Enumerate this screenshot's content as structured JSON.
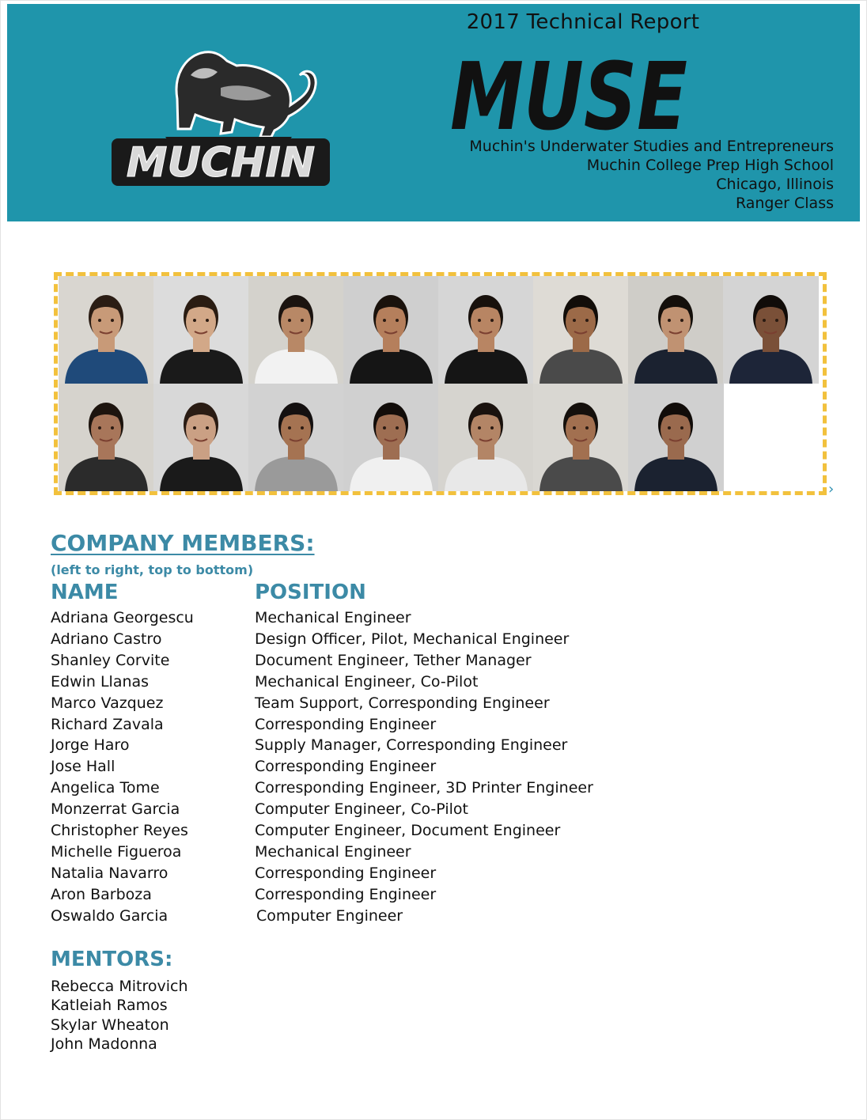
{
  "banner": {
    "report_title": "2017 Technical Report",
    "company_short": "MUSE",
    "logo_text": "MUCHIN",
    "company_full": "Muchin's Underwater Studies and Entrepreneurs",
    "school": "Muchin College Prep High School",
    "location": "Chicago, Illinois",
    "class": "Ranger Class",
    "background_color": "#1f95ab"
  },
  "photos": {
    "row1": [
      {
        "shirt": "#1f4a7a",
        "bg": "#d9d6d0",
        "skin": "#c89a78",
        "hair": "#2b1d14"
      },
      {
        "shirt": "#1a1a1a",
        "bg": "#dcdcdc",
        "skin": "#d2a888",
        "hair": "#2a1c12"
      },
      {
        "shirt": "#f2f2f2",
        "bg": "#d4d2cc",
        "skin": "#b88866",
        "hair": "#1b1410"
      },
      {
        "shirt": "#151515",
        "bg": "#cfcfcf",
        "skin": "#b57f5c",
        "hair": "#1a120c"
      },
      {
        "shirt": "#151515",
        "bg": "#d6d6d6",
        "skin": "#b88563",
        "hair": "#18110c"
      },
      {
        "shirt": "#4a4a4a",
        "bg": "#dedbd5",
        "skin": "#9c6a48",
        "hair": "#120d09"
      },
      {
        "shirt": "#1b2230",
        "bg": "#cfcdc8",
        "skin": "#c09272",
        "hair": "#140f0b"
      },
      {
        "shirt": "#1d2538",
        "bg": "#d4d4d4",
        "skin": "#7a5038",
        "hair": "#110c09"
      }
    ],
    "row2": [
      {
        "shirt": "#2b2b2b",
        "bg": "#d6d3cd",
        "skin": "#a8765a",
        "hair": "#1d140e"
      },
      {
        "shirt": "#1a1a1a",
        "bg": "#d8d8d8",
        "skin": "#caa084",
        "hair": "#2a1c14"
      },
      {
        "shirt": "#9a9a9a",
        "bg": "#d2d2d2",
        "skin": "#a57352",
        "hair": "#141010"
      },
      {
        "shirt": "#f0f0f0",
        "bg": "#d0d0d0",
        "skin": "#9e6e52",
        "hair": "#120d0a"
      },
      {
        "shirt": "#e8e8e8",
        "bg": "#d6d4cf",
        "skin": "#b38566",
        "hair": "#1a120e"
      },
      {
        "shirt": "#4a4a4a",
        "bg": "#d9d7d2",
        "skin": "#a27050",
        "hair": "#15100c"
      },
      {
        "shirt": "#1b2230",
        "bg": "#d0d0d0",
        "skin": "#9a6a4e",
        "hair": "#110c09"
      }
    ]
  },
  "members": {
    "title": "COMPANY MEMBERS:",
    "note": "(left to right, top to bottom)",
    "name_header": "NAME",
    "position_header": "POSITION",
    "rows": [
      {
        "name": "Adriana Georgescu",
        "position": "Mechanical Engineer"
      },
      {
        "name": "Adriano Castro",
        "position": "Design Officer, Pilot, Mechanical Engineer"
      },
      {
        "name": "Shanley Corvite",
        "position": "Document Engineer, Tether Manager"
      },
      {
        "name": "Edwin Llanas",
        "position": "Mechanical Engineer, Co-Pilot"
      },
      {
        "name": "Marco Vazquez",
        "position": "Team Support, Corresponding Engineer"
      },
      {
        "name": "Richard Zavala",
        "position": "Corresponding Engineer"
      },
      {
        "name": " Jorge Haro",
        "position": "Supply Manager, Corresponding Engineer"
      },
      {
        "name": "Jose Hall",
        "position": "Corresponding Engineer"
      },
      {
        "name": "Angelica Tome",
        "position": "Corresponding Engineer, 3D Printer Engineer"
      },
      {
        "name": "Monzerrat Garcia",
        "position": "Computer Engineer, Co-Pilot"
      },
      {
        "name": "Christopher Reyes",
        "position": "Computer Engineer, Document Engineer"
      },
      {
        "name": "Michelle Figueroa",
        "position": "Mechanical Engineer"
      },
      {
        "name": "Natalia Navarro",
        "position": "Corresponding Engineer"
      },
      {
        "name": "Aron Barboza",
        "position": "Corresponding Engineer"
      },
      {
        "name": "Oswaldo Garcia",
        "position": "Computer Engineer"
      }
    ]
  },
  "mentors": {
    "title": "MENTORS:",
    "names": [
      "Rebecca Mitrovich",
      "Katleiah Ramos",
      "Skylar Wheaton",
      "John Madonna"
    ]
  },
  "accent_color": "#3c8aa6",
  "frame_color": "#f2c13d"
}
